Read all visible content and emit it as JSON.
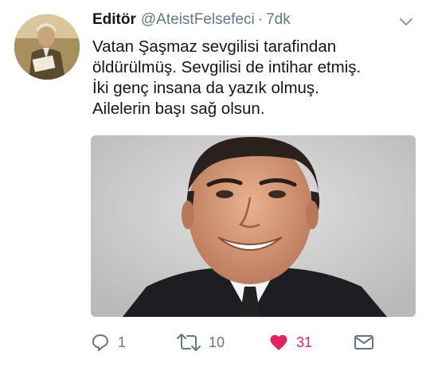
{
  "tweet": {
    "author": {
      "display_name": "Editör",
      "handle": "@AteistFelsefeci",
      "separator": "·",
      "time": "7dk"
    },
    "text_lines": [
      "Vatan Şaşmaz sevgilisi tarafindan",
      "öldürülmüş. Sevgilisi de intihar etmiş.",
      "İki genç insana da yazık olmuş.",
      "Ailelerin başı sağ olsun."
    ],
    "actions": {
      "reply_count": "1",
      "retweet_count": "10",
      "like_count": "31",
      "liked": true
    },
    "icons": {
      "reply": "reply-icon",
      "retweet": "retweet-icon",
      "like": "heart-icon",
      "dm": "envelope-icon",
      "menu": "chevron-down-icon"
    },
    "colors": {
      "like_active": "#e0245e",
      "secondary_text": "#657786",
      "primary_text": "#14171a"
    }
  }
}
